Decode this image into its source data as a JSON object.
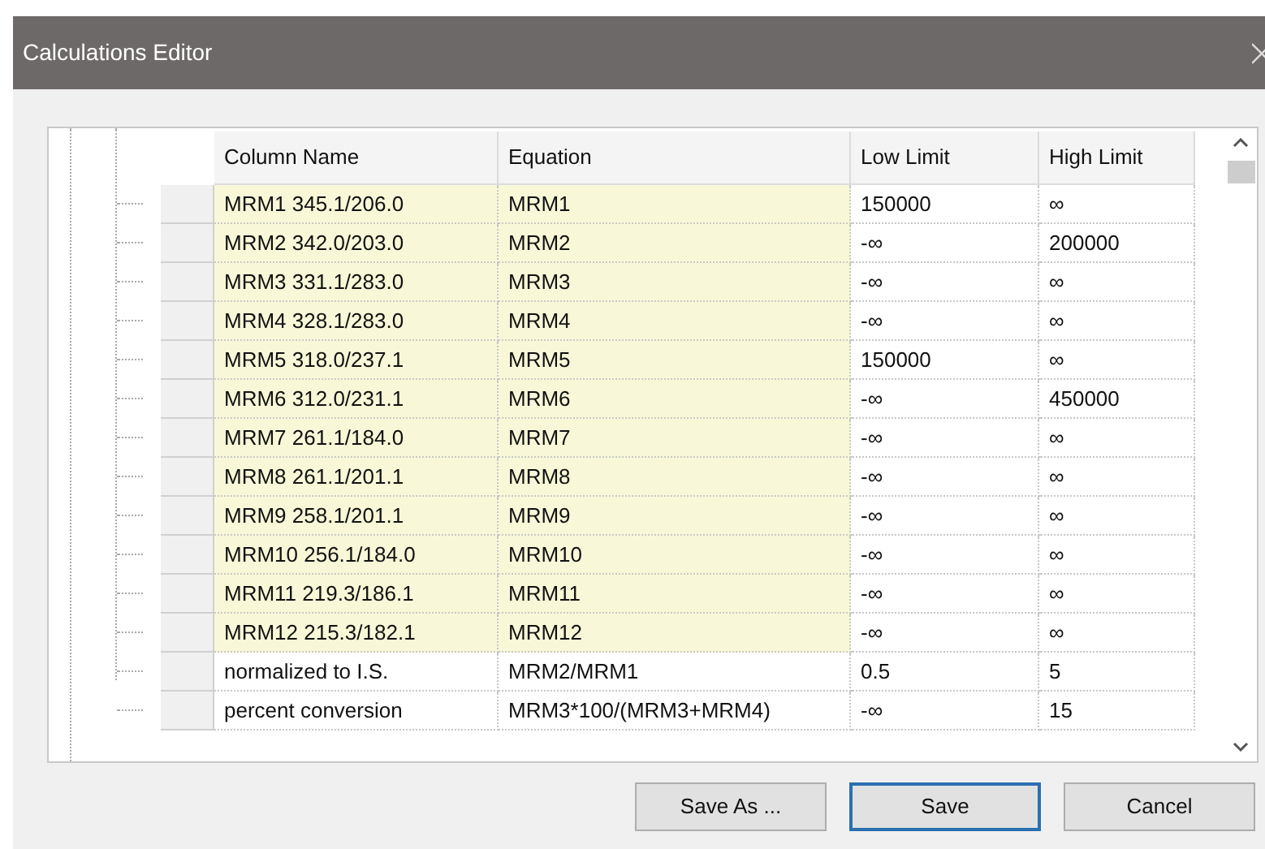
{
  "window": {
    "title": "Calculations Editor"
  },
  "table": {
    "columns": [
      "Column Name",
      "Equation",
      "Low Limit",
      "High Limit"
    ],
    "rows": [
      {
        "name": "MRM1 345.1/206.0",
        "equation": "MRM1",
        "low": "150000",
        "high": "∞",
        "highlighted": true
      },
      {
        "name": "MRM2 342.0/203.0",
        "equation": "MRM2",
        "low": "-∞",
        "high": "200000",
        "highlighted": true
      },
      {
        "name": "MRM3 331.1/283.0",
        "equation": "MRM3",
        "low": "-∞",
        "high": "∞",
        "highlighted": true
      },
      {
        "name": "MRM4 328.1/283.0",
        "equation": "MRM4",
        "low": "-∞",
        "high": "∞",
        "highlighted": true
      },
      {
        "name": "MRM5 318.0/237.1",
        "equation": "MRM5",
        "low": "150000",
        "high": "∞",
        "highlighted": true
      },
      {
        "name": "MRM6 312.0/231.1",
        "equation": "MRM6",
        "low": "-∞",
        "high": "450000",
        "highlighted": true
      },
      {
        "name": "MRM7 261.1/184.0",
        "equation": "MRM7",
        "low": "-∞",
        "high": "∞",
        "highlighted": true
      },
      {
        "name": "MRM8 261.1/201.1",
        "equation": "MRM8",
        "low": "-∞",
        "high": "∞",
        "highlighted": true
      },
      {
        "name": "MRM9 258.1/201.1",
        "equation": "MRM9",
        "low": "-∞",
        "high": "∞",
        "highlighted": true
      },
      {
        "name": "MRM10 256.1/184.0",
        "equation": "MRM10",
        "low": "-∞",
        "high": "∞",
        "highlighted": true
      },
      {
        "name": "MRM11 219.3/186.1",
        "equation": "MRM11",
        "low": "-∞",
        "high": "∞",
        "highlighted": true
      },
      {
        "name": "MRM12 215.3/182.1",
        "equation": "MRM12",
        "low": "-∞",
        "high": "∞",
        "highlighted": true
      },
      {
        "name": "normalized to I.S.",
        "equation": "MRM2/MRM1",
        "low": "0.5",
        "high": "5",
        "highlighted": false
      },
      {
        "name": "percent conversion",
        "equation": "MRM3*100/(MRM3+MRM4)",
        "low": "-∞",
        "high": "15",
        "highlighted": false
      }
    ]
  },
  "buttons": [
    {
      "label": "Save As ...",
      "default": false
    },
    {
      "label": "Save",
      "default": true
    },
    {
      "label": "Cancel",
      "default": false
    }
  ]
}
